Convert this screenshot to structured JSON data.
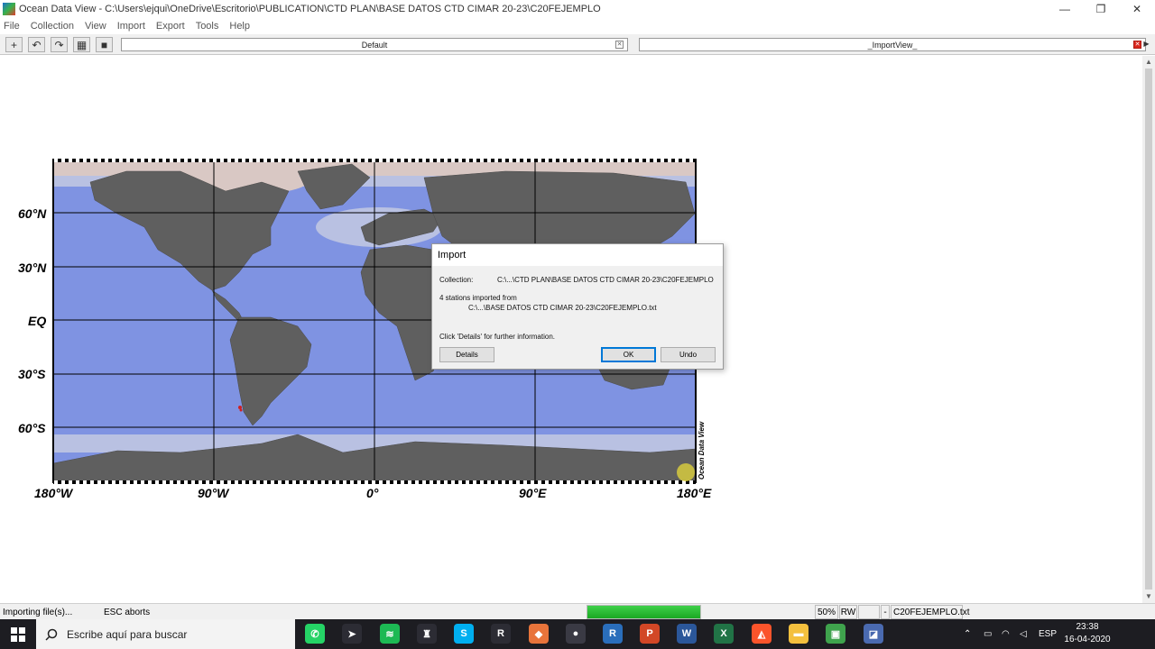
{
  "window": {
    "title": "Ocean Data View - C:\\Users\\ejqui\\OneDrive\\Escritorio\\PUBLICATION\\CTD PLAN\\BASE DATOS CTD CIMAR 20-23\\C20FEJEMPLO",
    "minimize": "—",
    "maximize": "❐",
    "close": "✕"
  },
  "menu": [
    "File",
    "Collection",
    "View",
    "Import",
    "Export",
    "Tools",
    "Help"
  ],
  "toolbar": {
    "buttons": [
      {
        "icon": "plus-icon",
        "glyph": "+"
      },
      {
        "icon": "undo-icon",
        "glyph": "↶"
      },
      {
        "icon": "redo-icon",
        "glyph": "↷"
      },
      {
        "icon": "grid-icon",
        "glyph": "▦"
      },
      {
        "icon": "save-icon",
        "glyph": "■"
      }
    ],
    "tabs": [
      {
        "label": "Default",
        "close": "✕"
      },
      {
        "label": "_ImportView_",
        "close": "✕"
      }
    ],
    "arrow": "▶"
  },
  "map": {
    "lat_labels": [
      "60°N",
      "30°N",
      "EQ",
      "30°S",
      "60°S"
    ],
    "lon_labels": [
      "180°W",
      "90°W",
      "0°",
      "90°E",
      "180°E"
    ],
    "brand": "Ocean Data View",
    "colors": {
      "land": "#5f5f5f",
      "ocean": "#7f93e2",
      "shelf": "#c6ccdf",
      "ice": "#d9c8c4"
    }
  },
  "dialog": {
    "title": "Import",
    "collection_label": "Collection:",
    "collection_value": "C:\\...\\CTD PLAN\\BASE DATOS CTD CIMAR 20-23\\C20FEJEMPLO",
    "stations_line": "4 stations imported from",
    "source_path": "C:\\...\\BASE DATOS CTD CIMAR 20-23\\C20FEJEMPLO.txt",
    "info": "Click 'Details' for further information.",
    "details_button": "Details",
    "ok_button": "OK",
    "undo_button": "Undo"
  },
  "status": {
    "left": "Importing file(s)...",
    "esc": "ESC aborts",
    "progress": 1.0,
    "zoom": "50%",
    "mode": "RW",
    "dash": "-",
    "file": "C20FEJEMPLO.txt"
  },
  "taskbar": {
    "search_placeholder": "Escribe aquí para buscar",
    "apps": [
      {
        "name": "whatsapp",
        "glyph": "✆",
        "color": "#25d366"
      },
      {
        "name": "app-bird",
        "glyph": "➤",
        "color": "#2c2c34"
      },
      {
        "name": "spotify",
        "glyph": "≋",
        "color": "#1db954"
      },
      {
        "name": "app-tool",
        "glyph": "♜",
        "color": "#2c2c34"
      },
      {
        "name": "skype",
        "glyph": "S",
        "color": "#00aff0"
      },
      {
        "name": "app-r6",
        "glyph": "R",
        "color": "#2c2c34"
      },
      {
        "name": "app-orange",
        "glyph": "◆",
        "color": "#e8743b"
      },
      {
        "name": "app-sphere",
        "glyph": "●",
        "color": "#3a3a44"
      },
      {
        "name": "r-lang",
        "glyph": "R",
        "color": "#2a6ebb"
      },
      {
        "name": "powerpoint",
        "glyph": "P",
        "color": "#d24726"
      },
      {
        "name": "word",
        "glyph": "W",
        "color": "#2b579a"
      },
      {
        "name": "excel",
        "glyph": "X",
        "color": "#217346"
      },
      {
        "name": "brave",
        "glyph": "◭",
        "color": "#fb542b"
      },
      {
        "name": "file-explorer",
        "glyph": "▬",
        "color": "#f4c03e"
      },
      {
        "name": "app-green",
        "glyph": "▣",
        "color": "#3fa34d"
      },
      {
        "name": "ocean-data-view",
        "glyph": "◪",
        "color": "#4a6ab0"
      }
    ],
    "lang": "ESP",
    "time": "23:38",
    "date": "16-04-2020"
  }
}
